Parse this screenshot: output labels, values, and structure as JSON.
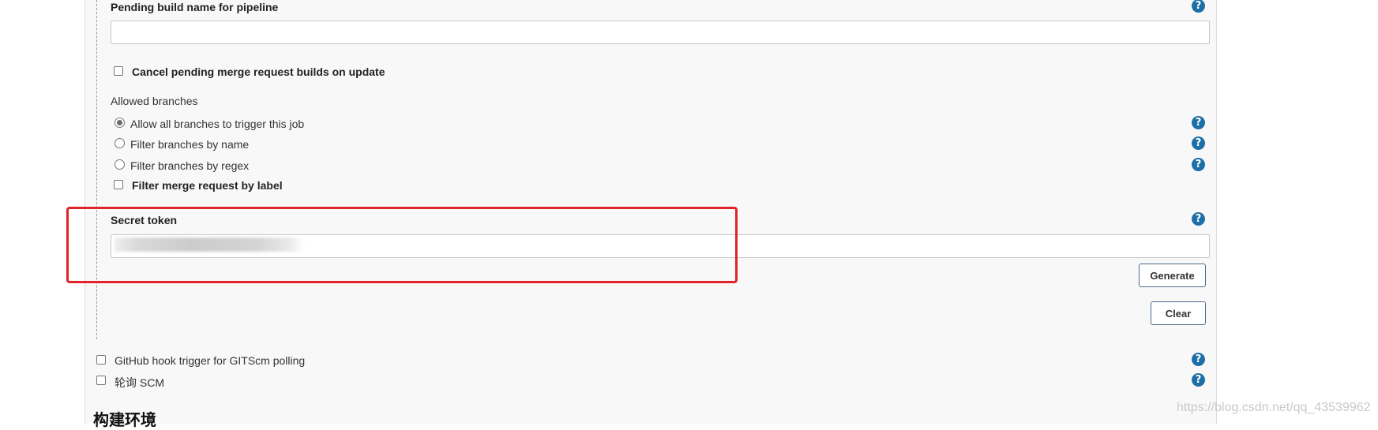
{
  "gitlab_trigger": {
    "pending_build_name": {
      "label": "Pending build name for pipeline",
      "value": ""
    },
    "cancel_pending_label": "Cancel pending merge request builds on update",
    "allowed_branches": {
      "heading": "Allowed branches",
      "options": [
        {
          "label": "Allow all branches to trigger this job",
          "checked": true
        },
        {
          "label": "Filter branches by name",
          "checked": false
        },
        {
          "label": "Filter branches by regex",
          "checked": false
        }
      ]
    },
    "filter_merge_request_label": "Filter merge request by label",
    "secret_token": {
      "label": "Secret token",
      "value": ""
    },
    "generate_button": "Generate",
    "clear_button": "Clear"
  },
  "other_triggers": [
    {
      "label": "GitHub hook trigger for GITScm polling",
      "checked": false
    },
    {
      "label": "轮询 SCM",
      "checked": false
    }
  ],
  "build_env_heading": "构建环境",
  "help_symbol": "?",
  "watermark": "https://blog.csdn.net/qq_43539962",
  "colors": {
    "panel_background": "#f8f8f8",
    "help_icon": "#1e6fa8",
    "highlight_box": "#e0242a",
    "button_border": "#4b6b8a"
  }
}
